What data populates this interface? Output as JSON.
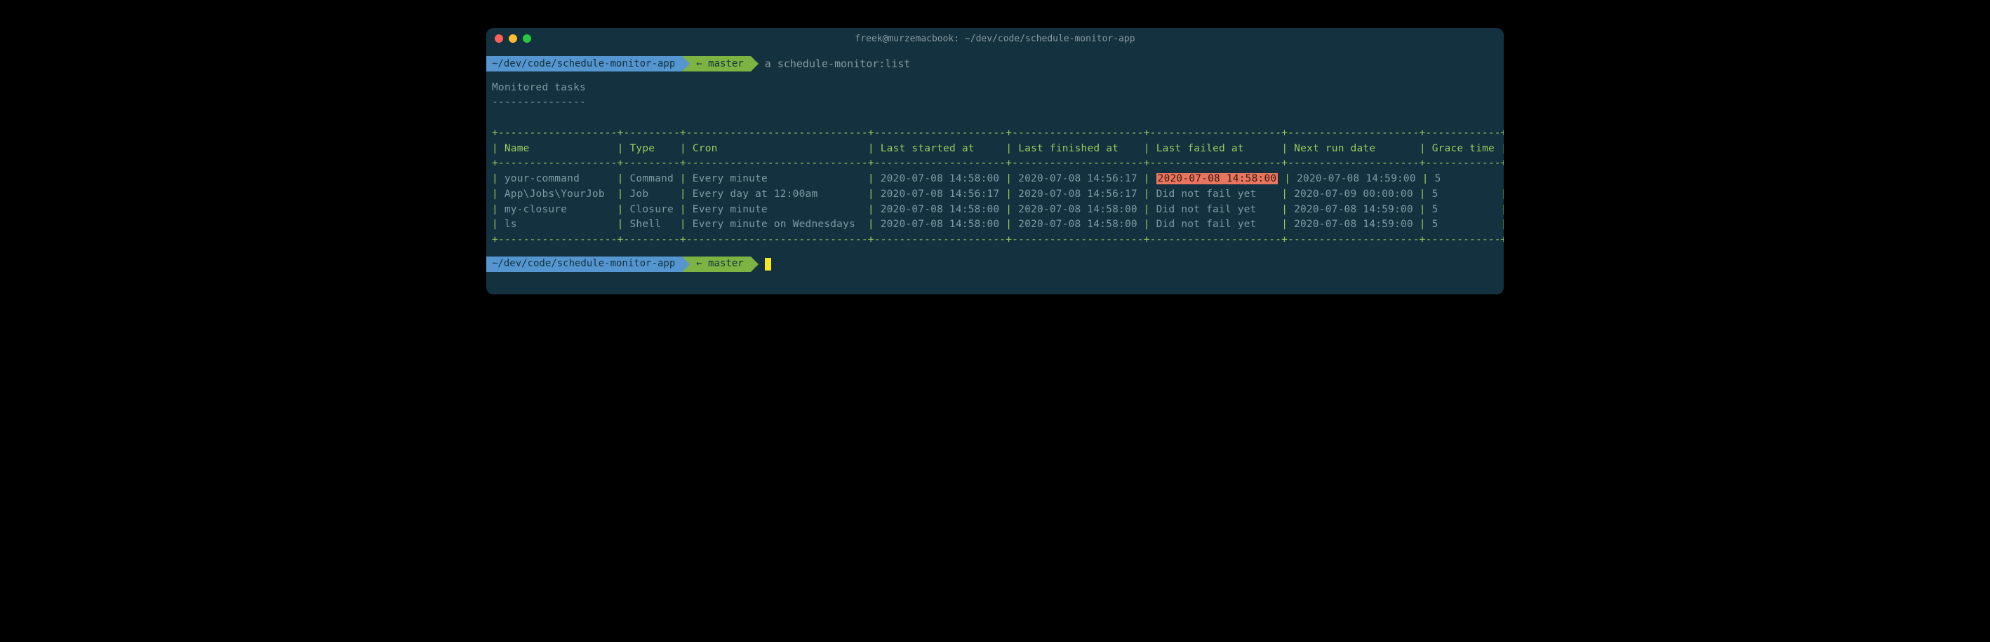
{
  "window": {
    "title": "freek@murzemacbook: ~/dev/code/schedule-monitor-app"
  },
  "prompt1": {
    "path": "~/dev/code/schedule-monitor-app",
    "branch": "← master",
    "command": "a schedule-monitor:list"
  },
  "prompt2": {
    "path": "~/dev/code/schedule-monitor-app",
    "branch": "← master"
  },
  "output": {
    "title": "Monitored tasks",
    "divider": "---------------",
    "border_top": "+-------------------+---------+-----------------------------+---------------------+---------------------+---------------------+---------------------+------------+",
    "header_row": {
      "name": "Name",
      "type": "Type",
      "cron": "Cron",
      "last_started": "Last started at",
      "last_finished": "Last finished at",
      "last_failed": "Last failed at",
      "next_run": "Next run date",
      "grace": "Grace time"
    },
    "border_mid": "+-------------------+---------+-----------------------------+---------------------+---------------------+---------------------+---------------------+------------+",
    "rows": [
      {
        "name": "your-command",
        "type": "Command",
        "cron": "Every minute",
        "last_started": "2020-07-08 14:58:00",
        "last_finished": "2020-07-08 14:56:17",
        "last_failed": "2020-07-08 14:58:00",
        "last_failed_highlight": true,
        "next_run": "2020-07-08 14:59:00",
        "grace": "5"
      },
      {
        "name": "App\\Jobs\\YourJob",
        "type": "Job",
        "cron": "Every day at 12:00am",
        "last_started": "2020-07-08 14:56:17",
        "last_finished": "2020-07-08 14:56:17",
        "last_failed": "Did not fail yet",
        "last_failed_highlight": false,
        "next_run": "2020-07-09 00:00:00",
        "grace": "5"
      },
      {
        "name": "my-closure",
        "type": "Closure",
        "cron": "Every minute",
        "last_started": "2020-07-08 14:58:00",
        "last_finished": "2020-07-08 14:58:00",
        "last_failed": "Did not fail yet",
        "last_failed_highlight": false,
        "next_run": "2020-07-08 14:59:00",
        "grace": "5"
      },
      {
        "name": "ls",
        "type": "Shell",
        "cron": "Every minute on Wednesdays",
        "last_started": "2020-07-08 14:58:00",
        "last_finished": "2020-07-08 14:58:00",
        "last_failed": "Did not fail yet",
        "last_failed_highlight": false,
        "next_run": "2020-07-08 14:59:00",
        "grace": "5"
      }
    ],
    "border_bot": "+-------------------+---------+-----------------------------+---------------------+---------------------+---------------------+---------------------+------------+"
  },
  "col_widths": {
    "name": 17,
    "type": 7,
    "cron": 27,
    "last_started": 19,
    "last_finished": 19,
    "last_failed": 19,
    "next_run": 19,
    "grace": 10
  }
}
